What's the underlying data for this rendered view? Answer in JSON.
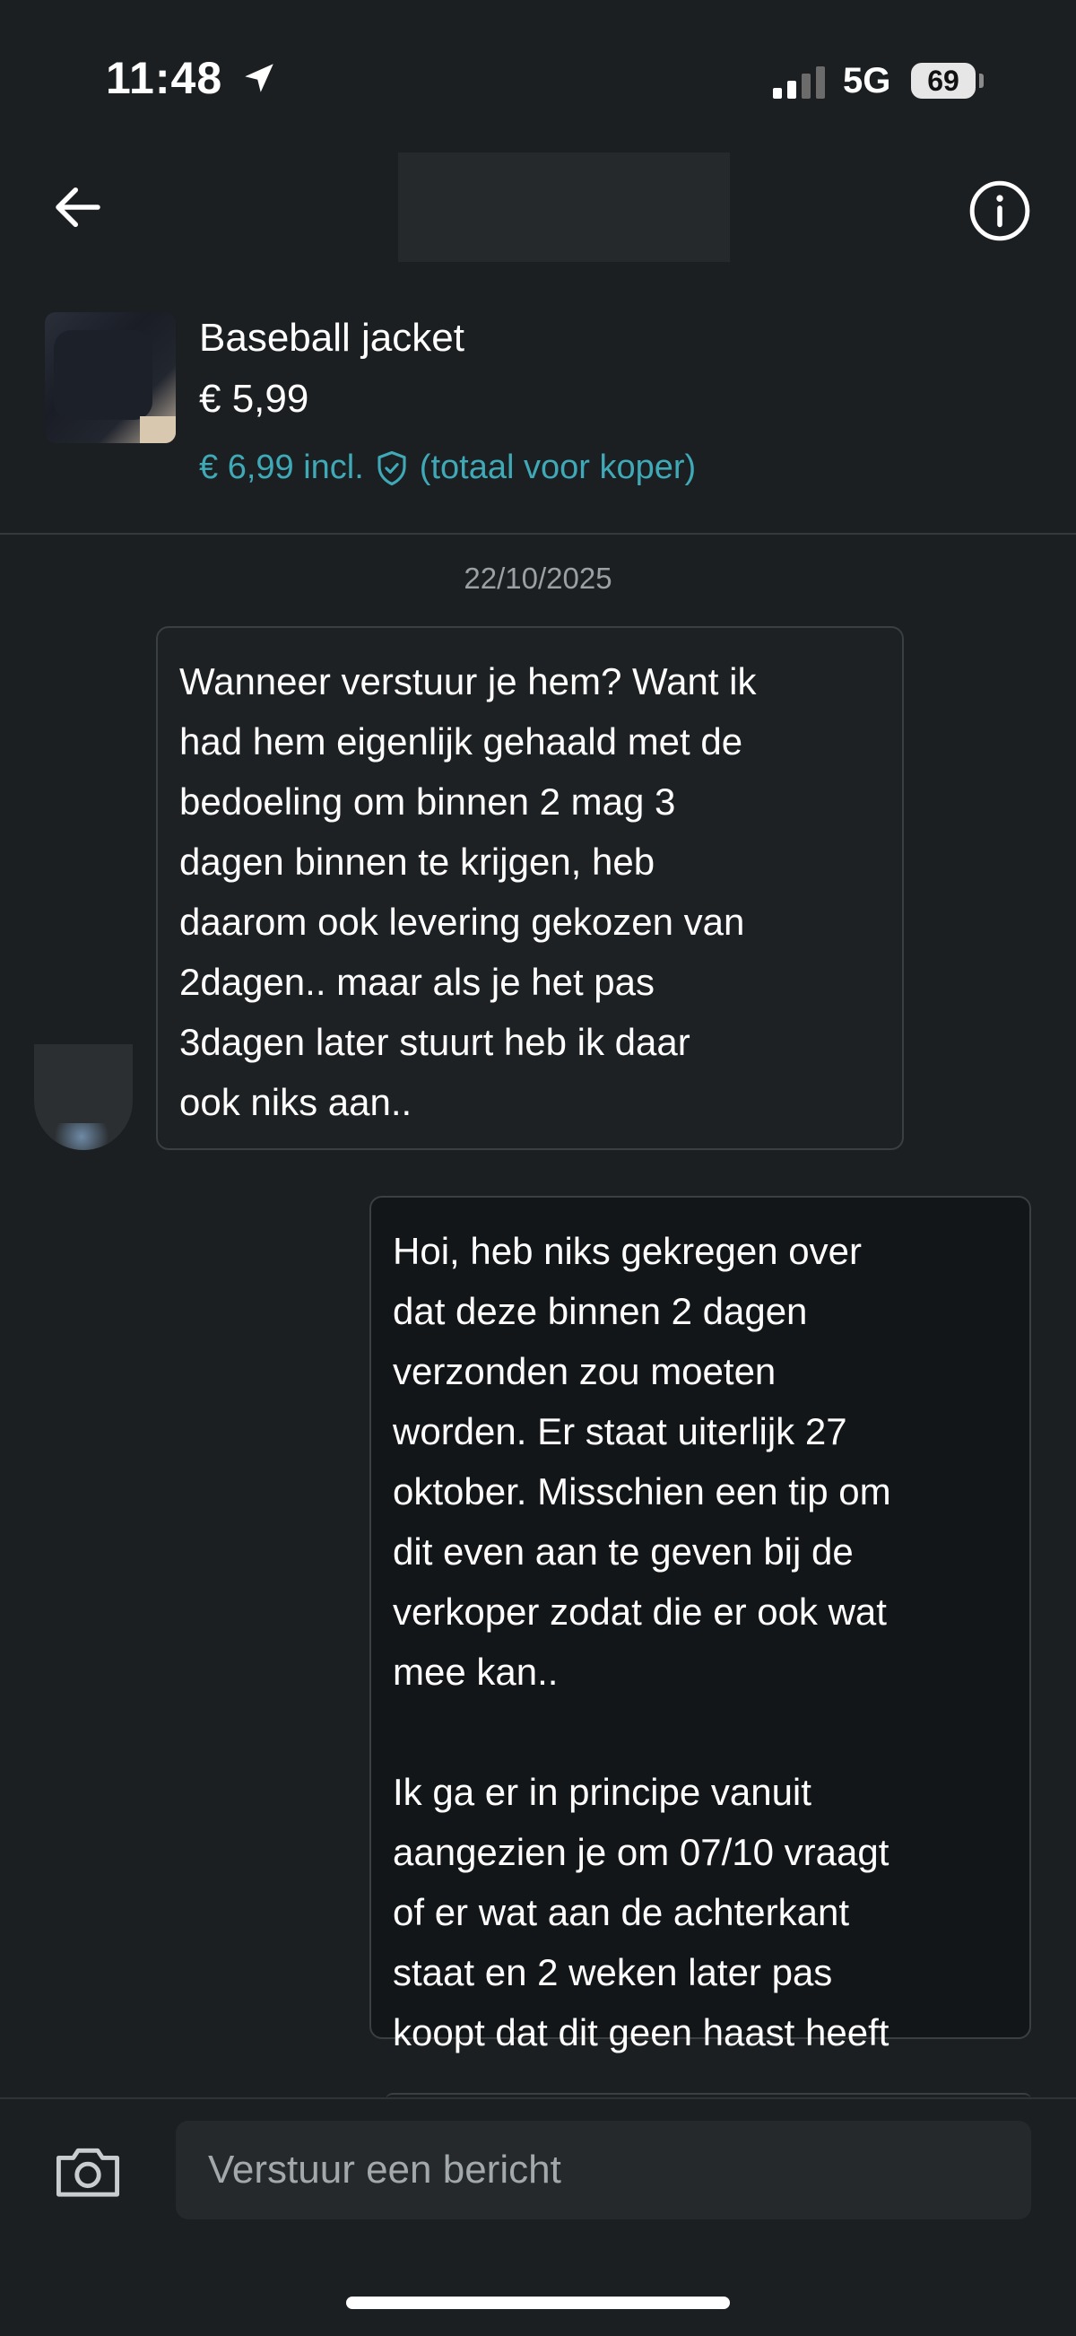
{
  "status_bar": {
    "time": "11:48",
    "network": "5G",
    "battery": "69"
  },
  "header": {
    "back_icon": "arrow-left-icon",
    "info_icon": "info-circle-icon"
  },
  "item": {
    "title": "Baseball jacket",
    "price": "€ 5,99",
    "total_price": "€ 6,99 incl.",
    "total_note": "(totaal voor koper)",
    "accent_color": "#3fa9b7"
  },
  "conversation": {
    "date": "22/10/2025",
    "messages": [
      {
        "direction": "incoming",
        "text": "Wanneer verstuur je hem? Want ik\nhad hem eigenlijk gehaald met de\nbedoeling om binnen 2 mag 3\ndagen binnen te krijgen, heb\ndaarom ook levering gekozen van\n2dagen.. maar als je het pas\n3dagen later stuurt heb ik daar\nook niks aan.."
      },
      {
        "direction": "outgoing",
        "text": "Hoi, heb niks gekregen over\ndat deze binnen 2 dagen\nverzonden zou moeten\nworden. Er staat uiterlijk 27\noktober. Misschien een tip om\ndit even aan te geven bij de\nverkoper zodat die er ook wat\nmee kan..\n\nIk ga er in principe vanuit\naangezien je om 07/10 vraagt\nof er wat aan de achterkant\nstaat en 2 weken later pas\nkoopt dat dit geen haast heeft"
      }
    ]
  },
  "composer": {
    "placeholder": "Verstuur een bericht",
    "camera_icon": "camera-icon"
  }
}
